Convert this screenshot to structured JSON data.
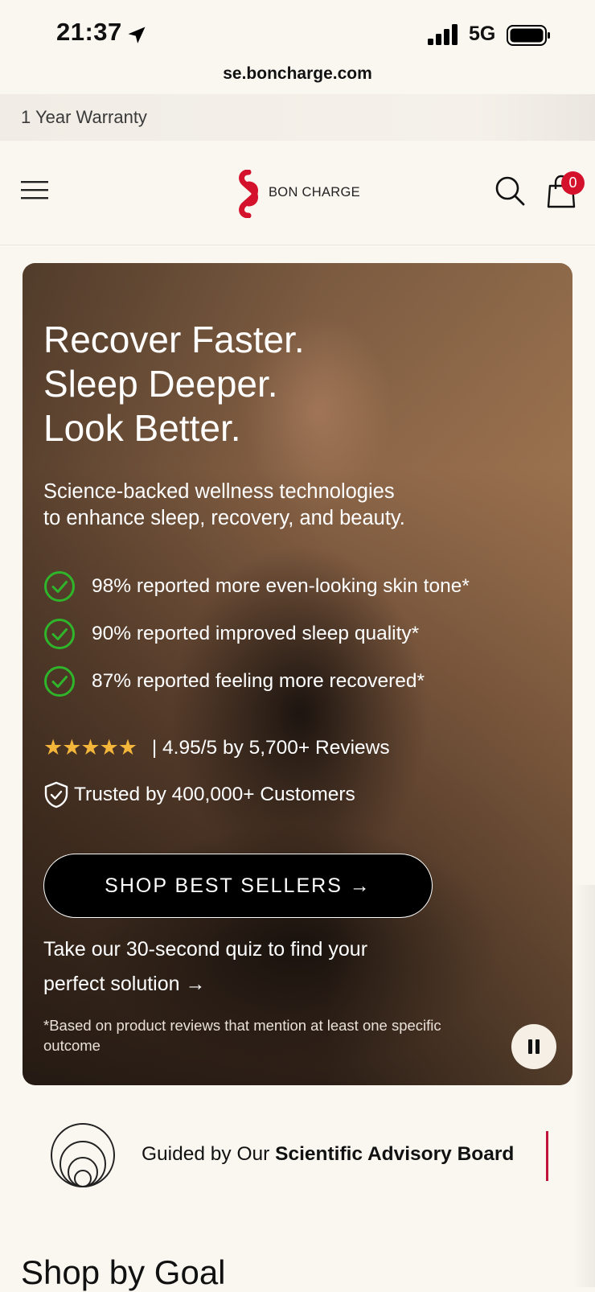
{
  "status_bar": {
    "time": "21:37",
    "network": "5G",
    "url": "se.boncharge.com"
  },
  "announcement": {
    "text": "1 Year Warranty"
  },
  "header": {
    "brand": "BON CHARGE",
    "cart_count": "0",
    "brand_color": "#d4122c"
  },
  "hero": {
    "headline": [
      "Recover Faster.",
      "Sleep Deeper.",
      "Look Better."
    ],
    "subhead": [
      "Science-backed wellness technologies",
      "to enhance sleep, recovery, and beauty."
    ],
    "benefits": [
      "98% reported more even-looking skin tone*",
      "90% reported improved sleep quality*",
      "87% reported feeling more recovered*"
    ],
    "stars": "★★★★★",
    "rating_text": "| 4.95/5 by 5,700+ Reviews",
    "trusted_text": "Trusted by 400,000+ Customers",
    "cta_label": "SHOP BEST SELLERS →",
    "quiz_text": "Take our 30-second quiz to find your perfect solution →",
    "footnote": "*Based on product reviews that mention at least one specific outcome",
    "check_color": "#2fb52a",
    "star_color": "#f3b53a"
  },
  "advisory": {
    "prefix": "Guided by Our ",
    "bold": "Scientific Advisory Board"
  },
  "section": {
    "title": "Shop by Goal"
  }
}
